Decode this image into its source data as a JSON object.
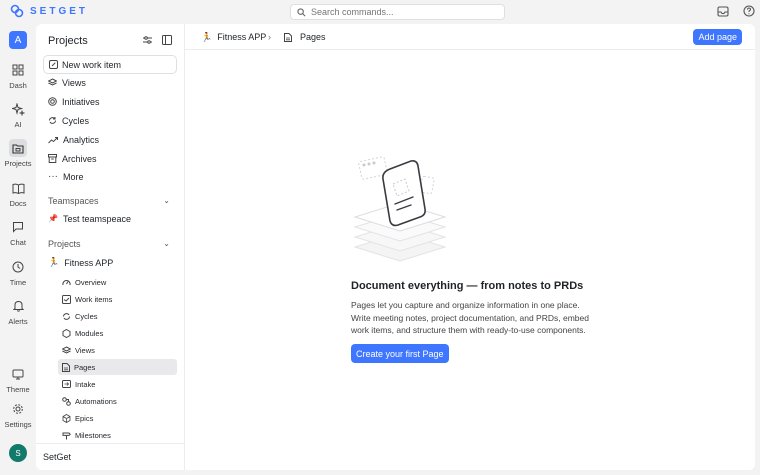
{
  "app": {
    "brand": "SETGET",
    "accent": "#3f76ff"
  },
  "search": {
    "placeholder": "Search commands..."
  },
  "rail": {
    "workspace_initial": "A",
    "user_initial": "S",
    "items": [
      {
        "label": "Dash",
        "icon": "dashboard-icon"
      },
      {
        "label": "AI",
        "icon": "sparkle-icon"
      },
      {
        "label": "Projects",
        "icon": "folder-icon"
      },
      {
        "label": "Docs",
        "icon": "book-icon"
      },
      {
        "label": "Chat",
        "icon": "chat-icon"
      },
      {
        "label": "Time",
        "icon": "clock-icon"
      },
      {
        "label": "Alerts",
        "icon": "bell-icon"
      },
      {
        "label": "Theme",
        "icon": "monitor-icon"
      },
      {
        "label": "Settings",
        "icon": "gear-icon"
      }
    ]
  },
  "sidebar": {
    "title": "Projects",
    "new_work_item": "New work item",
    "nav": [
      "Views",
      "Initiatives",
      "Cycles",
      "Analytics",
      "Archives",
      "More"
    ],
    "teamspaces_label": "Teamspaces",
    "teamspace": "Test teamspeace",
    "projects_label": "Projects",
    "project": "Fitness APP",
    "project_items": [
      "Overview",
      "Work items",
      "Cycles",
      "Modules",
      "Views",
      "Pages",
      "Intake",
      "Automations",
      "Epics",
      "Milestones"
    ],
    "active_item": "Pages",
    "footer": "SetGet"
  },
  "breadcrumb": {
    "project": "Fitness APP",
    "page": "Pages"
  },
  "header": {
    "add_page": "Add page"
  },
  "empty_state": {
    "title": "Document everything — from notes to PRDs",
    "description": "Pages let you capture and organize information in one place. Write meeting notes, project documentation, and PRDs, embed work items, and structure them with ready-to-use components.",
    "cta": "Create your first Page"
  }
}
